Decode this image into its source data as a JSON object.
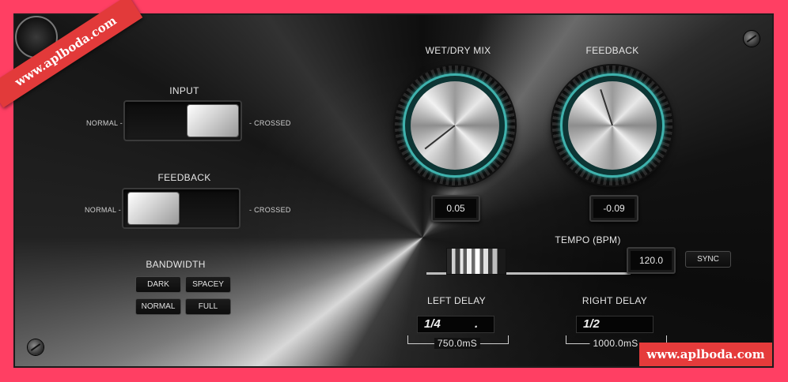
{
  "input": {
    "title": "INPUT",
    "left_label": "NORMAL -",
    "right_label": "- CROSSED",
    "state": "crossed"
  },
  "feedback_switch": {
    "title": "FEEDBACK",
    "left_label": "NORMAL -",
    "right_label": "- CROSSED",
    "state": "normal"
  },
  "bandwidth": {
    "title": "BANDWIDTH",
    "buttons": [
      "DARK",
      "SPACEY",
      "NORMAL",
      "FULL"
    ]
  },
  "knobs": {
    "wet_dry": {
      "label": "WET/DRY MIX",
      "value": "0.05",
      "pointer_color": "#333333"
    },
    "feedback": {
      "label": "FEEDBACK",
      "value": "-0.09"
    }
  },
  "tempo": {
    "label": "TEMPO (BPM)",
    "value": "120.0",
    "sync_label": "SYNC"
  },
  "left_delay": {
    "label": "LEFT DELAY",
    "note": "1/4",
    "modifier": ".",
    "ms": "750.0mS"
  },
  "right_delay": {
    "label": "RIGHT DELAY",
    "note": "1/2",
    "modifier": "",
    "ms": "1000.0mS"
  },
  "watermarks": {
    "corner": "www.aplboda.com",
    "bottom": "www.aplboda.com"
  },
  "colors": {
    "accent_teal": "#3fb2ad",
    "background": "#ff3f63"
  }
}
